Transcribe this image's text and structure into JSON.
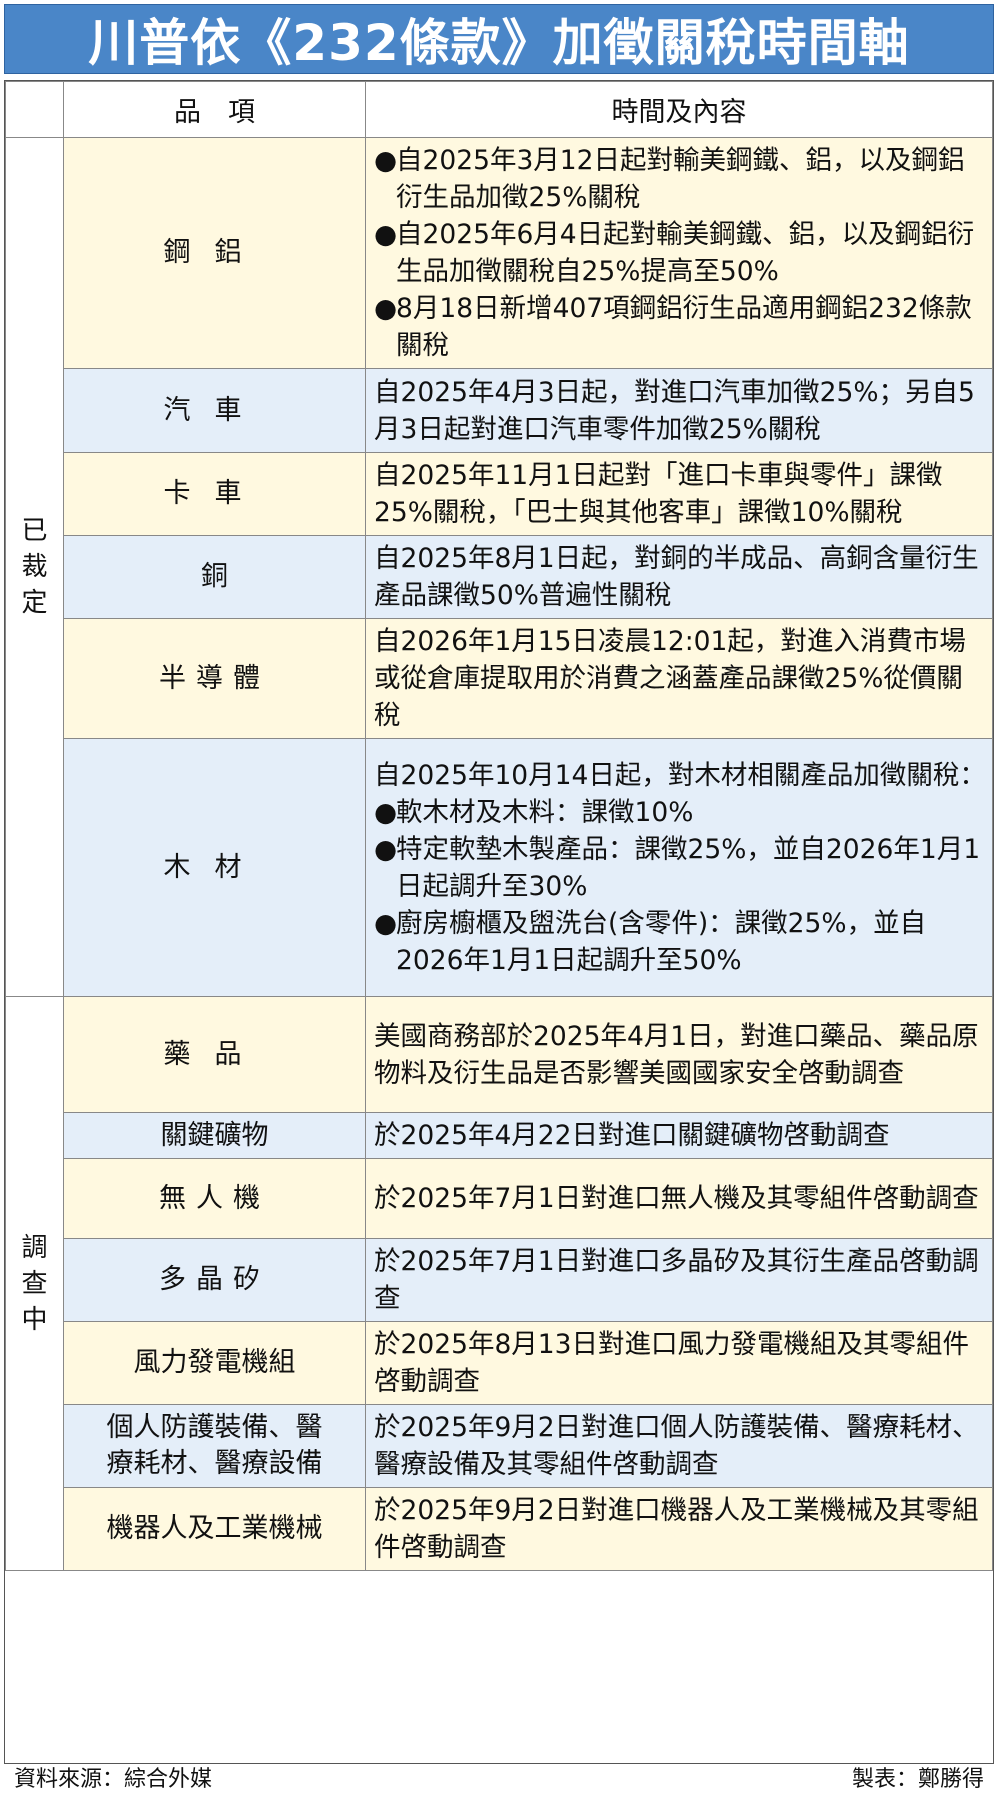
{
  "title": "川普依《232條款》加徵關稅時間軸",
  "header": {
    "col_status": "",
    "col_item": "品　項",
    "col_content": "時間及內容"
  },
  "groups": [
    {
      "status": "已裁定"
    },
    {
      "status": "調查中"
    }
  ],
  "rows": [
    {
      "item": "鋼鋁",
      "bullets": [
        "自2025年3月12日起對輸美鋼鐵、鋁，以及鋼鋁衍生品加徵25%關稅",
        "自2025年6月4日起對輸美鋼鐵、鋁，以及鋼鋁衍生品加徵關稅自25%提高至50%",
        "8月18日新增407項鋼鋁衍生品適用鋼鋁232條款關稅"
      ]
    },
    {
      "item": "汽車",
      "text": "自2025年4月3日起，對進口汽車加徵25%；另自5月3日起對進口汽車零件加徵25%關稅"
    },
    {
      "item": "卡車",
      "text": "自2025年11月1日起對「進口卡車與零件」課徵25%關稅，「巴士與其他客車」課徵10%關稅"
    },
    {
      "item": "銅",
      "text": "自2025年8月1日起，對銅的半成品、高銅含量衍生產品課徵50%普遍性關稅"
    },
    {
      "item": "半導體",
      "text": "自2026年1月15日凌晨12:01起，對進入消費市場或從倉庫提取用於消費之涵蓋產品課徵25%從價關稅"
    },
    {
      "item": "木材",
      "text": "自2025年10月14日起，對木材相關產品加徵關稅：",
      "bullets": [
        "軟木材及木料：課徵10%",
        "特定軟墊木製產品：課徵25%，並自2026年1月1日起調升至30%",
        "廚房櫥櫃及盥洗台(含零件)：課徵25%，並自2026年1月1日起調升至50%"
      ]
    },
    {
      "item": "藥品",
      "text": "美國商務部於2025年4月1日，對進口藥品、藥品原物料及衍生品是否影響美國國家安全啓動調查"
    },
    {
      "item": "關鍵礦物",
      "text": "於2025年4月22日對進口關鍵礦物啓動調查"
    },
    {
      "item": "無人機",
      "text": "於2025年7月1日對進口無人機及其零組件啓動調查"
    },
    {
      "item": "多晶矽",
      "text": "於2025年7月1日對進口多晶矽及其衍生產品啓動調查"
    },
    {
      "item": "風力發電機組",
      "text": "於2025年8月13日對進口風力發電機組及其零組件啓動調查"
    },
    {
      "item": "個人防護裝備、醫療耗材、醫療設備",
      "text": "於2025年9月2日對進口個人防護裝備、醫療耗材、醫療設備及其零組件啓動調查"
    },
    {
      "item": "機器人及工業機械",
      "text": "於2025年9月2日對進口機器人及工業機械及其零組件啓動調查"
    }
  ],
  "bullet_symbol": "●",
  "footer": {
    "source": "資料來源：綜合外媒",
    "author": "製表：鄭勝得"
  },
  "colors": {
    "title_bg": "#4a86c8",
    "row_yellow": "#fff9e0",
    "row_blue": "#e4eef9"
  }
}
